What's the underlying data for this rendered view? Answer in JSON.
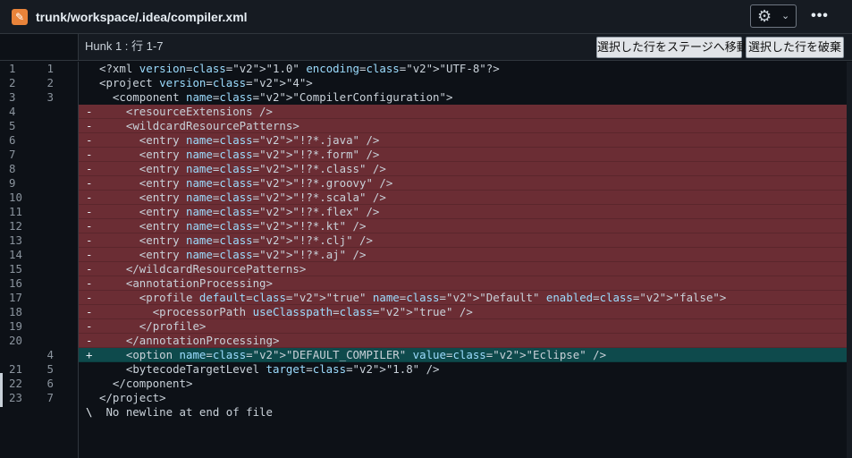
{
  "header": {
    "file_icon": "pencil-icon",
    "path": "trunk/workspace/.idea/compiler.xml",
    "settings_icon": "⚙",
    "chevron": "⌄",
    "more": "•••"
  },
  "hunk": {
    "label": "Hunk 1 : 行 1-7",
    "stage_label": "選択した行をステージへ移動",
    "discard_label": "選択した行を破棄"
  },
  "lines": [
    {
      "old": "1",
      "new": "1",
      "type": "ctx",
      "marker": "",
      "code": "<?xml version=\"1.0\" encoding=\"UTF-8\"?>"
    },
    {
      "old": "2",
      "new": "2",
      "type": "ctx",
      "marker": "",
      "code": "<project version=\"4\">"
    },
    {
      "old": "3",
      "new": "3",
      "type": "ctx",
      "marker": "",
      "code": "  <component name=\"CompilerConfiguration\">"
    },
    {
      "old": "4",
      "new": "",
      "type": "del",
      "marker": "-",
      "code": "    <resourceExtensions />"
    },
    {
      "old": "5",
      "new": "",
      "type": "del",
      "marker": "-",
      "code": "    <wildcardResourcePatterns>"
    },
    {
      "old": "6",
      "new": "",
      "type": "del",
      "marker": "-",
      "code": "      <entry name=\"!?*.java\" />"
    },
    {
      "old": "7",
      "new": "",
      "type": "del",
      "marker": "-",
      "code": "      <entry name=\"!?*.form\" />"
    },
    {
      "old": "8",
      "new": "",
      "type": "del",
      "marker": "-",
      "code": "      <entry name=\"!?*.class\" />"
    },
    {
      "old": "9",
      "new": "",
      "type": "del",
      "marker": "-",
      "code": "      <entry name=\"!?*.groovy\" />"
    },
    {
      "old": "10",
      "new": "",
      "type": "del",
      "marker": "-",
      "code": "      <entry name=\"!?*.scala\" />"
    },
    {
      "old": "11",
      "new": "",
      "type": "del",
      "marker": "-",
      "code": "      <entry name=\"!?*.flex\" />"
    },
    {
      "old": "12",
      "new": "",
      "type": "del",
      "marker": "-",
      "code": "      <entry name=\"!?*.kt\" />"
    },
    {
      "old": "13",
      "new": "",
      "type": "del",
      "marker": "-",
      "code": "      <entry name=\"!?*.clj\" />"
    },
    {
      "old": "14",
      "new": "",
      "type": "del",
      "marker": "-",
      "code": "      <entry name=\"!?*.aj\" />"
    },
    {
      "old": "15",
      "new": "",
      "type": "del",
      "marker": "-",
      "code": "    </wildcardResourcePatterns>"
    },
    {
      "old": "16",
      "new": "",
      "type": "del",
      "marker": "-",
      "code": "    <annotationProcessing>"
    },
    {
      "old": "17",
      "new": "",
      "type": "del",
      "marker": "-",
      "code": "      <profile default=\"true\" name=\"Default\" enabled=\"false\">"
    },
    {
      "old": "18",
      "new": "",
      "type": "del",
      "marker": "-",
      "code": "        <processorPath useClasspath=\"true\" />"
    },
    {
      "old": "19",
      "new": "",
      "type": "del",
      "marker": "-",
      "code": "      </profile>"
    },
    {
      "old": "20",
      "new": "",
      "type": "del",
      "marker": "-",
      "code": "    </annotationProcessing>"
    },
    {
      "old": "",
      "new": "4",
      "type": "add",
      "marker": "+",
      "code": "    <option name=\"DEFAULT_COMPILER\" value=\"Eclipse\" />"
    },
    {
      "old": "21",
      "new": "5",
      "type": "ctx",
      "marker": "",
      "code": "    <bytecodeTargetLevel target=\"1.8\" />"
    },
    {
      "old": "22",
      "new": "6",
      "type": "ctx",
      "marker": "",
      "code": "  </component>"
    },
    {
      "old": "23",
      "new": "7",
      "type": "ctx",
      "marker": "",
      "code": "</project>"
    },
    {
      "old": "",
      "new": "",
      "type": "ctx",
      "marker": "\\",
      "code": " No newline at end of file"
    }
  ],
  "colors": {
    "deleted_bg": "#6b2d34",
    "added_bg": "#0e4a4c",
    "background": "#0d1117"
  }
}
